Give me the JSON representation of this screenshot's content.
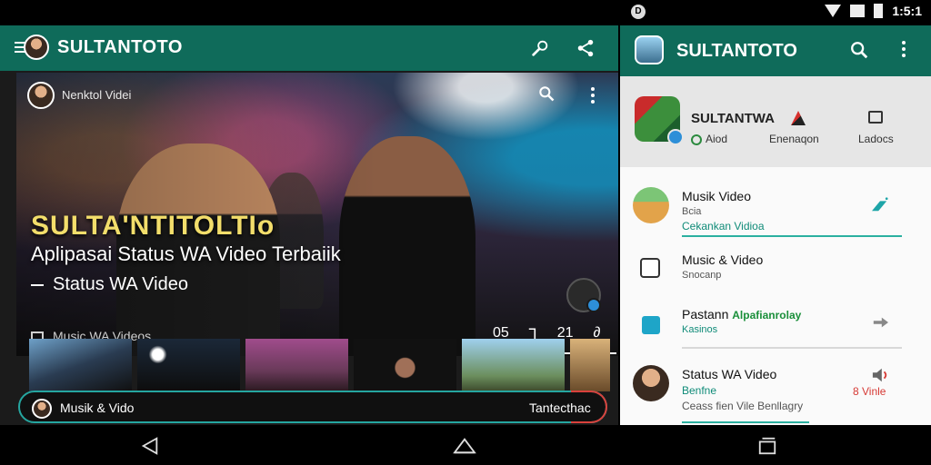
{
  "status_bar": {
    "left_icon": "D",
    "time": "1:5:1"
  },
  "left_app": {
    "title": "SULTANTOTO",
    "hero": {
      "channel_name": "Nenktol Videi",
      "title": "SULTA'NTITOLTIo",
      "subtitle": "Aplipasai Status WA Video Terbaiik",
      "subtitle2": "Status WA Video",
      "meta": "Music WA Videos",
      "controls": [
        "05",
        "⅂",
        "21",
        "∂"
      ]
    },
    "bottom_bar": {
      "label": "Musik & Vido",
      "right_label": "Tantecthac"
    }
  },
  "right_app": {
    "title": "SULTANTOTO",
    "profile": {
      "name": "SULTANTWA",
      "sub_left": "Aiod",
      "sub_mid": "Enenaqon",
      "sub_right": "Ladocs"
    },
    "items": [
      {
        "title": "Musik Video",
        "line2": "Bcia",
        "line3": "Cekankan Vidioa"
      },
      {
        "title": "Music & Video",
        "line2": "Snocanp"
      },
      {
        "title": "Pastann",
        "title_accent": "Alpafianrolay",
        "line2": "Kasinos"
      },
      {
        "title": "Status WA Video",
        "line2": "Benfne",
        "line3": "Ceass fien Vile Benllagry",
        "action": "8 Vinle"
      }
    ]
  },
  "colors": {
    "primary": "#0f6b5a",
    "accent_teal": "#25a6a0",
    "hero_title": "#f3de6b"
  }
}
